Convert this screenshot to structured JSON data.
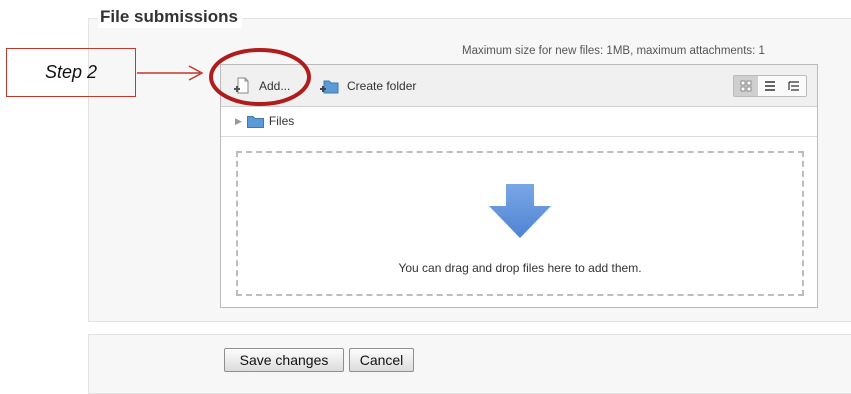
{
  "section": {
    "legend": "File submissions",
    "max_size_text": "Maximum size for new files: 1MB, maximum attachments: 1"
  },
  "filepicker": {
    "toolbar": {
      "add_label": "Add...",
      "create_folder_label": "Create folder",
      "view_modes": [
        "icons",
        "list",
        "tree"
      ],
      "active_view": "icons"
    },
    "path": {
      "folder_label": "Files"
    },
    "dropzone": {
      "message": "You can drag and drop files here to add them."
    }
  },
  "actions": {
    "save_label": "Save changes",
    "cancel_label": "Cancel"
  },
  "annotation": {
    "step_label": "Step 2",
    "highlight_color": "#b01c1c"
  },
  "colors": {
    "folder": "#5b9bd5",
    "drop_arrow": "#5b8fd8"
  }
}
